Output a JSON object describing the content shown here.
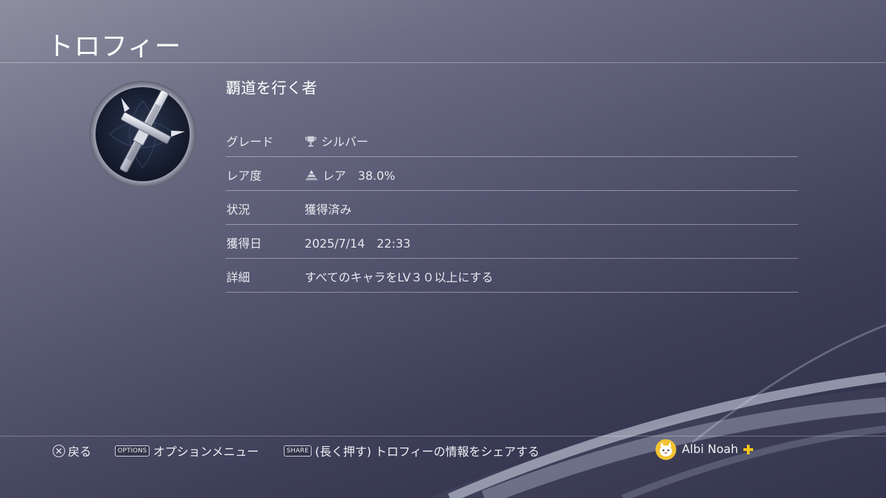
{
  "header": {
    "title": "トロフィー"
  },
  "trophy": {
    "name": "覇道を行く者",
    "icon": "silver-sword-trophy-icon",
    "rows": [
      {
        "label": "グレード",
        "value": "シルバー",
        "icon": "trophy-cup-icon"
      },
      {
        "label": "レア度",
        "value": "レア　38.0%",
        "icon": "rarity-pyramid-icon"
      },
      {
        "label": "状況",
        "value": "獲得済み"
      },
      {
        "label": "獲得日",
        "value": "2025/7/14　22:33"
      },
      {
        "label": "詳細",
        "value": "すべてのキャラをLV３０以上にする"
      }
    ]
  },
  "footer": {
    "back_label": "戻る",
    "options_key": "OPTIONS",
    "options_label": "オプションメニュー",
    "share_key": "SHARE",
    "share_label": "(長く押す) トロフィーの情報をシェアする",
    "user_name": "Albi Noah"
  },
  "colors": {
    "plus_badge": "#f5c518",
    "avatar_bg": "#f2c233"
  }
}
